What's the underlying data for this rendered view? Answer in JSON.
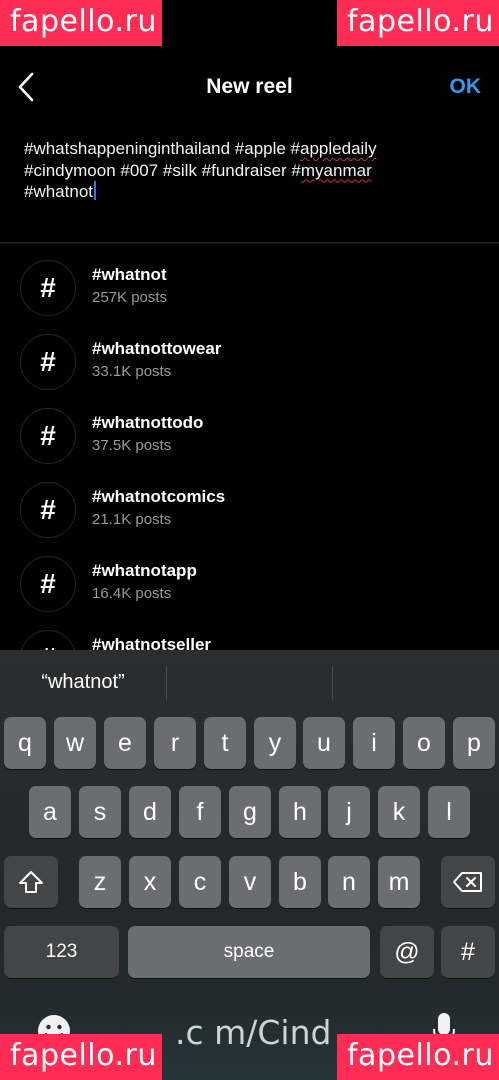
{
  "watermark": "fapello.ru",
  "header": {
    "title": "New reel",
    "ok_label": "OK"
  },
  "caption": {
    "line1_a": "#whatshappeninginthailand #apple #",
    "line1_b": "appledaily",
    "line2_a": "#cindymoon #007 #silk #fundraiser #",
    "line2_b": "myanmar",
    "line3": "#whatnot"
  },
  "suggestions": [
    {
      "tag": "#whatnot",
      "count": "257K posts"
    },
    {
      "tag": "#whatnottowear",
      "count": "33.1K posts"
    },
    {
      "tag": "#whatnottodo",
      "count": "37.5K posts"
    },
    {
      "tag": "#whatnotcomics",
      "count": "21.1K posts"
    },
    {
      "tag": "#whatnotapp",
      "count": "16.4K posts"
    },
    {
      "tag": "#whatnotseller",
      "count": ""
    }
  ],
  "hash_glyph": "#",
  "keyboard": {
    "prediction": "“whatnot”",
    "row1": [
      "q",
      "w",
      "e",
      "r",
      "t",
      "y",
      "u",
      "i",
      "o",
      "p"
    ],
    "row2": [
      "a",
      "s",
      "d",
      "f",
      "g",
      "h",
      "j",
      "k",
      "l"
    ],
    "row3": [
      "z",
      "x",
      "c",
      "v",
      "b",
      "n",
      "m"
    ],
    "numbers_label": "123",
    "space_label": "space",
    "at_label": "@",
    "hash_label": "#"
  },
  "bottom_text": ".c m/Cind",
  "icons": [
    "back-chevron-icon",
    "hashtag-icon",
    "shift-icon",
    "backspace-icon",
    "emoji-icon",
    "microphone-icon"
  ],
  "colors": {
    "accent": "#3897f0",
    "watermark": "#ff2d55",
    "key": "#6b6d70",
    "key_dark": "#434547"
  }
}
